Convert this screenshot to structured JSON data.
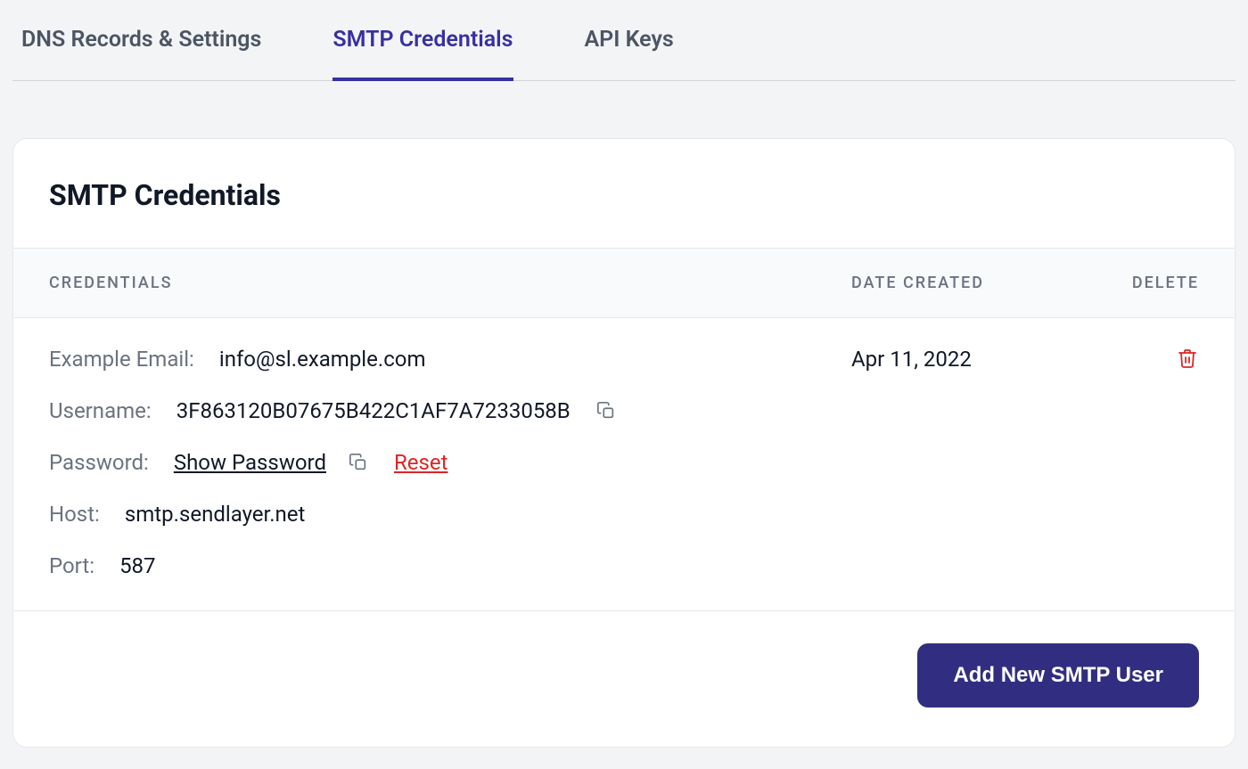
{
  "tabs": {
    "dns": "DNS Records & Settings",
    "smtp": "SMTP Credentials",
    "api": "API Keys"
  },
  "card": {
    "title": "SMTP Credentials"
  },
  "columns": {
    "credentials": "CREDENTIALS",
    "date": "DATE CREATED",
    "delete": "DELETE"
  },
  "row": {
    "email_label": "Example Email:",
    "email_value": "info@sl.example.com",
    "username_label": "Username:",
    "username_value": "3F863120B07675B422C1AF7A7233058B",
    "password_label": "Password:",
    "show_password": "Show Password",
    "reset": "Reset",
    "host_label": "Host:",
    "host_value": "smtp.sendlayer.net",
    "port_label": "Port:",
    "port_value": "587",
    "date_created": "Apr 11, 2022"
  },
  "footer": {
    "add_button": "Add New SMTP User"
  }
}
